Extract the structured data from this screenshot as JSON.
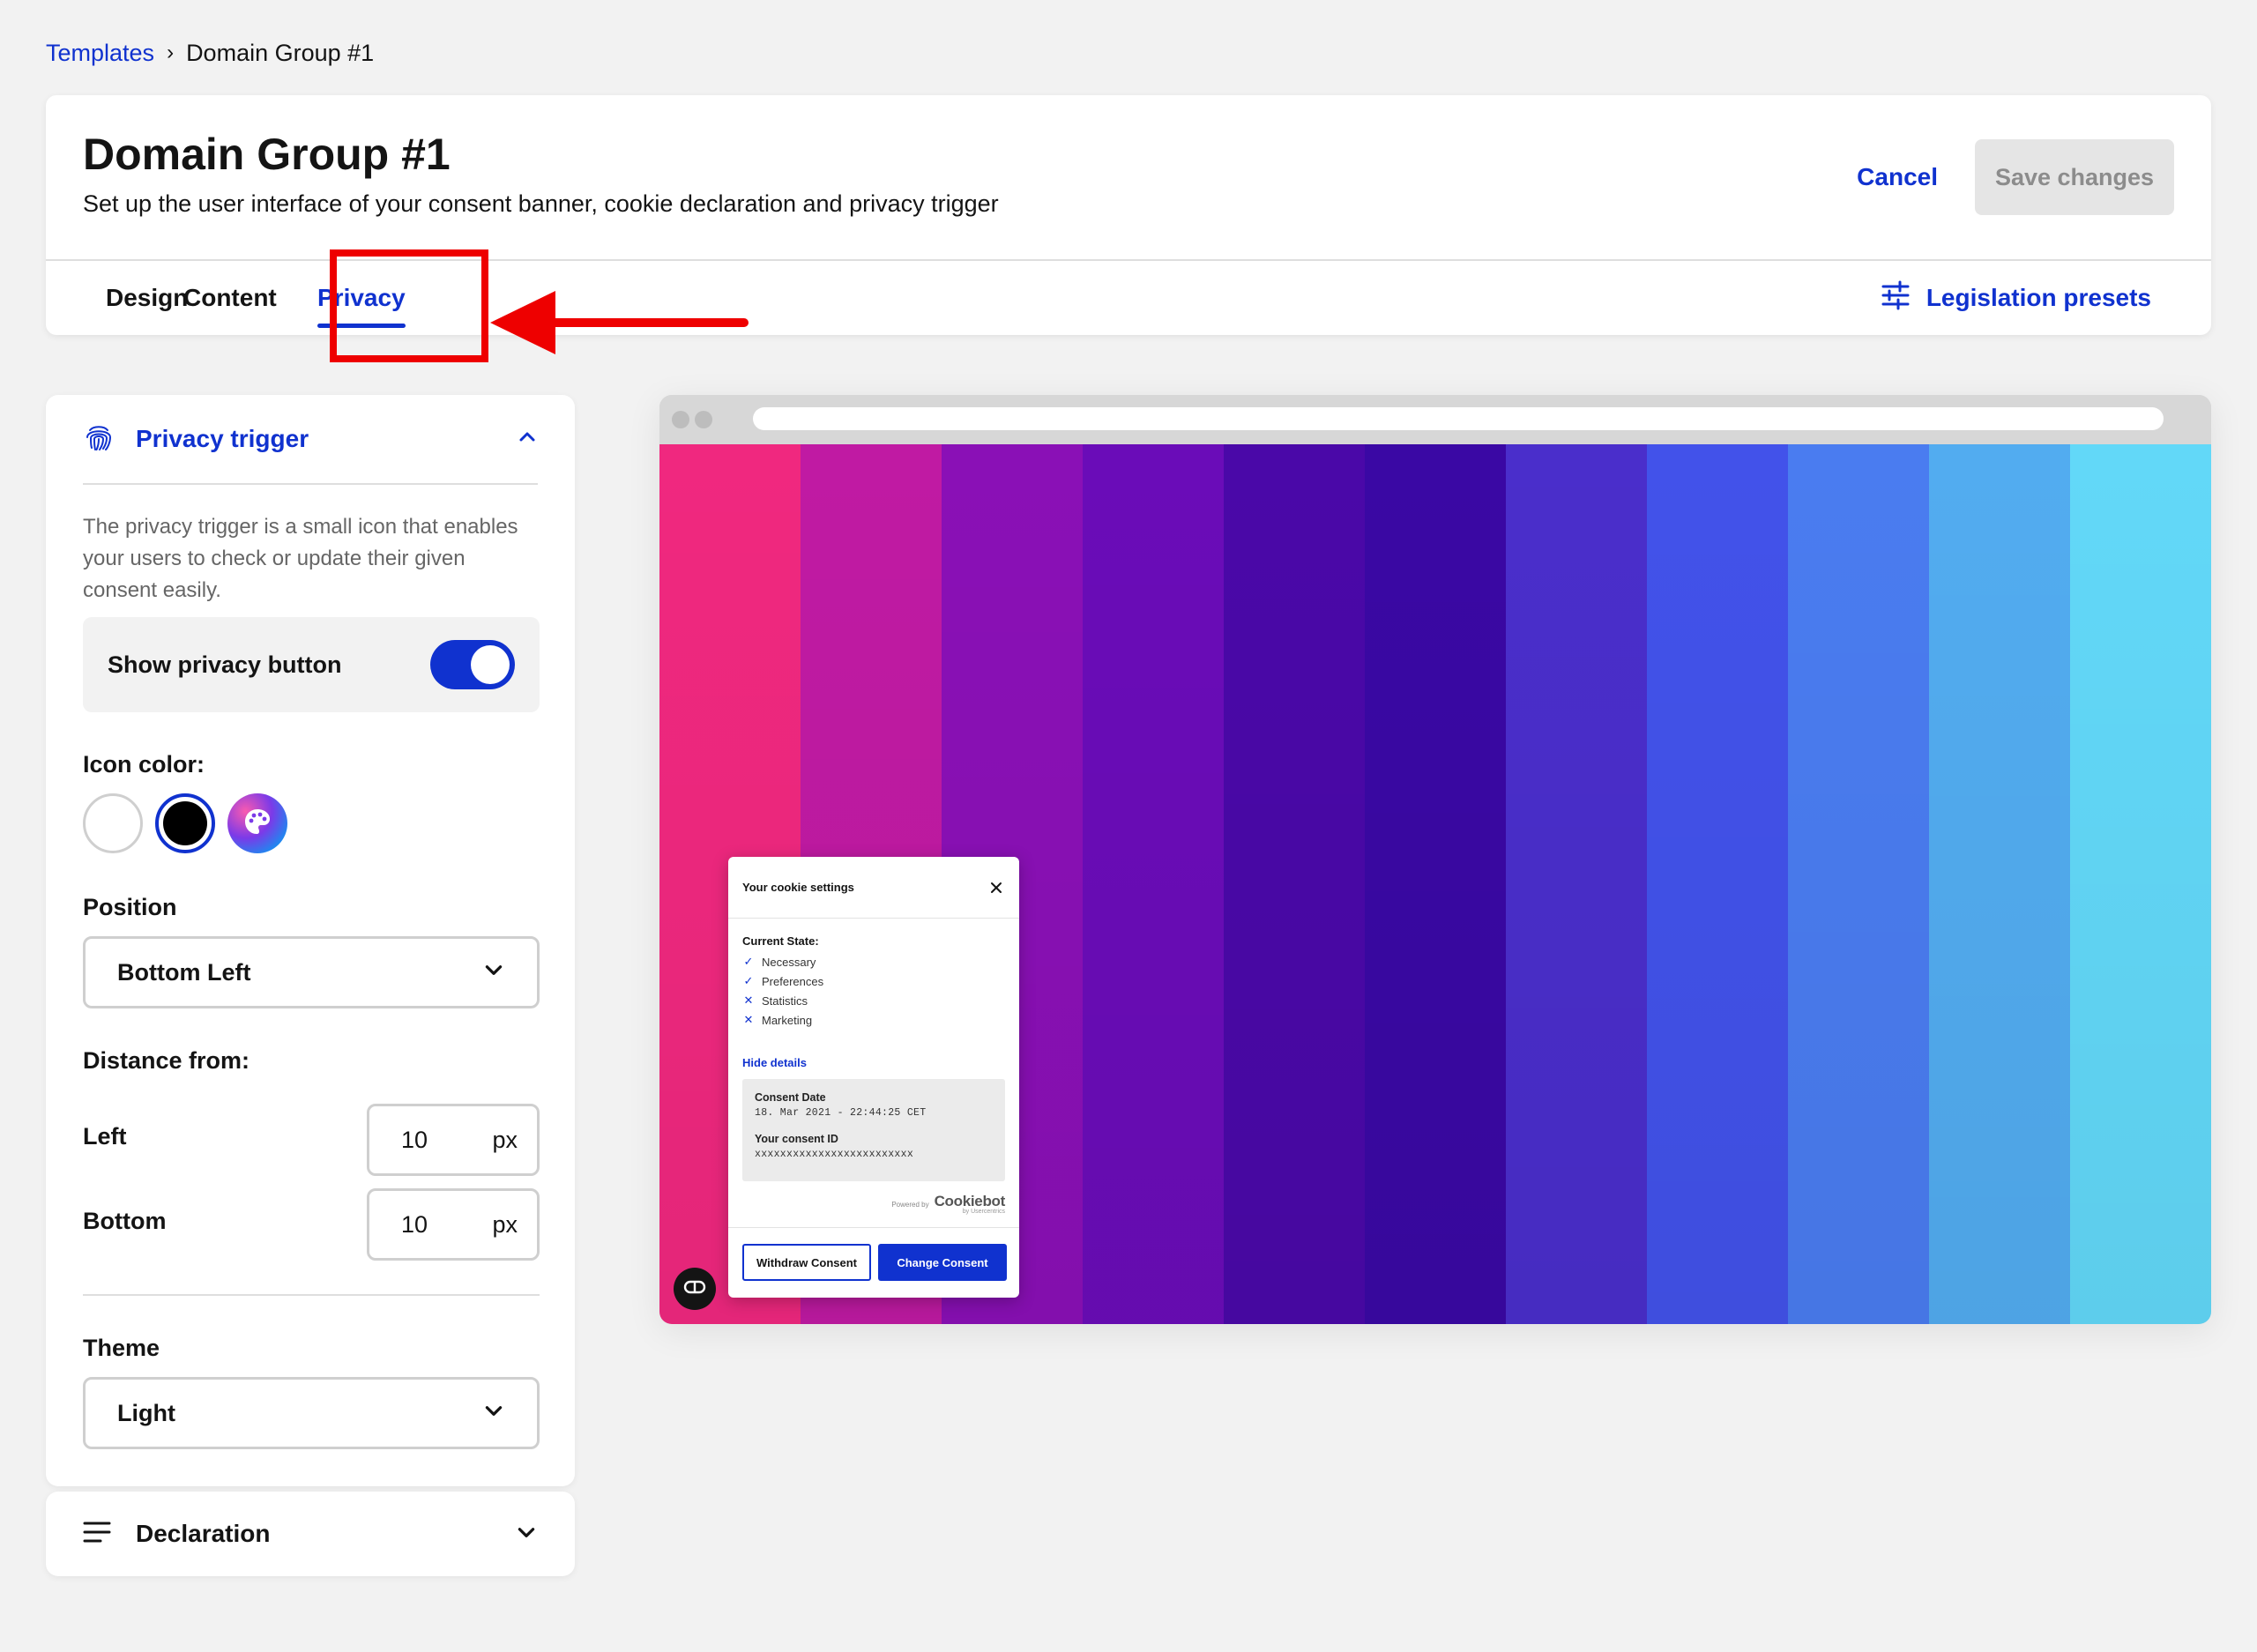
{
  "breadcrumb": {
    "parent": "Templates",
    "separator": "›",
    "current": "Domain Group #1"
  },
  "header": {
    "title": "Domain Group #1",
    "subtitle": "Set up the user interface of your consent banner, cookie declaration and privacy trigger",
    "cancel_label": "Cancel",
    "save_label": "Save changes",
    "tabs": [
      {
        "label": "Design"
      },
      {
        "label": "Content"
      },
      {
        "label": "Privacy",
        "active": true
      }
    ],
    "legislation_label": "Legislation presets",
    "accent_color": "#1032cf"
  },
  "annotation": {
    "color": "#ee0000",
    "target": "Privacy tab"
  },
  "privacy_trigger": {
    "title": "Privacy trigger",
    "description": "The privacy trigger is a small icon that enables your users to check or update their given consent easily.",
    "show_button_label": "Show privacy button",
    "show_button_on": true,
    "icon_color_label": "Icon color:",
    "icon_colors": [
      {
        "name": "white",
        "value": "#ffffff"
      },
      {
        "name": "black",
        "value": "#000000",
        "selected": true
      },
      {
        "name": "custom-palette-icon",
        "value": "custom"
      }
    ],
    "position_label": "Position",
    "position_value": "Bottom Left",
    "distance_label": "Distance from:",
    "left_label": "Left",
    "left_value": "10",
    "bottom_label": "Bottom",
    "bottom_value": "10",
    "unit": "px",
    "theme_label": "Theme",
    "theme_value": "Light"
  },
  "declaration": {
    "title": "Declaration"
  },
  "preview": {
    "stripes": [
      "#f0287f",
      "#c01aa3",
      "#8a10b6",
      "#6a0cb8",
      "#4a08a8",
      "#3a08a4",
      "#4a2ecb",
      "#4252ea",
      "#4a7cf0",
      "#52acf0",
      "#62d8f8"
    ],
    "popup": {
      "title": "Your cookie settings",
      "state_label": "Current State:",
      "items": [
        {
          "label": "Necessary",
          "status": "check"
        },
        {
          "label": "Preferences",
          "status": "check"
        },
        {
          "label": "Statistics",
          "status": "cross"
        },
        {
          "label": "Marketing",
          "status": "cross"
        }
      ],
      "hide_details": "Hide details",
      "consent_date_label": "Consent Date",
      "consent_date_value": "18. Mar 2021 - 22:44:25 CET",
      "consent_id_label": "Your consent ID",
      "consent_id_value": "xxxxxxxxxxxxxxxxxxxxxxxxx",
      "powered_by": "Powered by",
      "brand": "Cookiebot",
      "brand_sub": "by Usercentrics",
      "withdraw_label": "Withdraw Consent",
      "change_label": "Change Consent"
    }
  }
}
